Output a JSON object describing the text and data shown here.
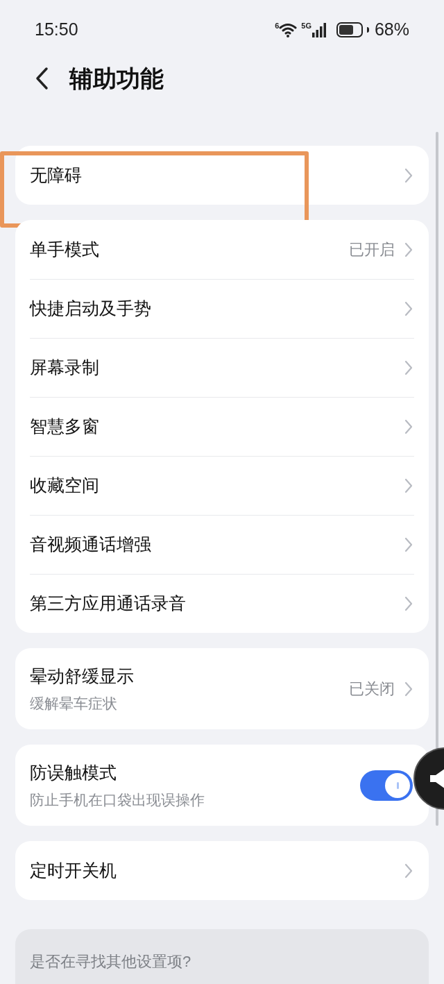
{
  "status_bar": {
    "time": "15:50",
    "wifi_label": "6",
    "network": "5G",
    "battery": "68%"
  },
  "header": {
    "title": "辅助功能"
  },
  "groups": [
    {
      "items": [
        {
          "kind": "link",
          "title": "无障碍",
          "highlighted": true
        }
      ]
    },
    {
      "items": [
        {
          "kind": "link",
          "title": "单手模式",
          "value": "已开启"
        },
        {
          "kind": "link",
          "title": "快捷启动及手势"
        },
        {
          "kind": "link",
          "title": "屏幕录制"
        },
        {
          "kind": "link",
          "title": "智慧多窗"
        },
        {
          "kind": "link",
          "title": "收藏空间"
        },
        {
          "kind": "link",
          "title": "音视频通话增强"
        },
        {
          "kind": "link",
          "title": "第三方应用通话录音"
        }
      ]
    },
    {
      "items": [
        {
          "kind": "link",
          "title": "晕动舒缓显示",
          "subtitle": "缓解晕车症状",
          "value": "已关闭"
        }
      ]
    },
    {
      "items": [
        {
          "kind": "toggle",
          "title": "防误触模式",
          "subtitle": "防止手机在口袋出现误操作",
          "on": true
        }
      ]
    },
    {
      "items": [
        {
          "kind": "link",
          "title": "定时开关机"
        }
      ]
    }
  ],
  "footer": {
    "text": "是否在寻找其他设置项?"
  }
}
